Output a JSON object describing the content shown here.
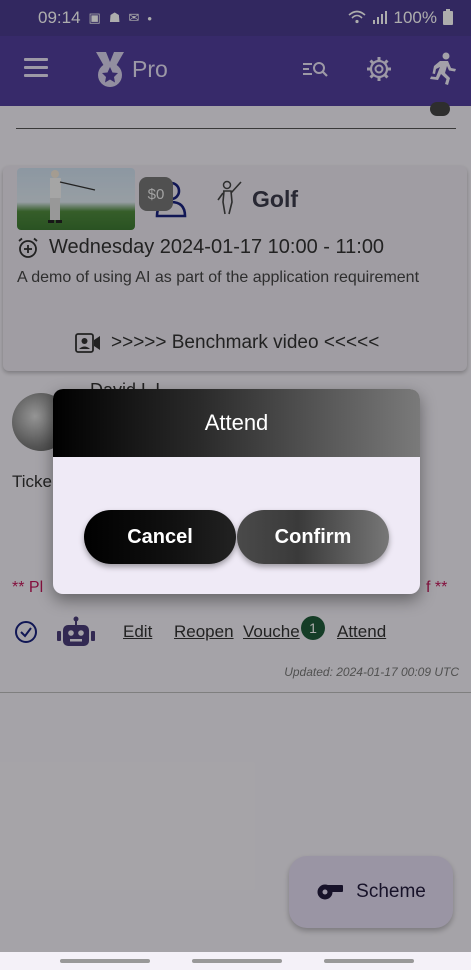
{
  "statusbar": {
    "time": "09:14",
    "battery": "100%"
  },
  "appbar": {
    "brand": "Pro"
  },
  "event": {
    "price": "$0",
    "sport": "Golf",
    "datetime": "Wednesday 2024-01-17 10:00 - 11:00",
    "description": "A demo of using AI as part of the application requirement",
    "video_label": ">>>>> Benchmark video <<<<<"
  },
  "host": {
    "name": "David L L"
  },
  "tickets_label": "Ticke",
  "notice_left": "** Pl",
  "notice_right": "f **",
  "actions": {
    "edit": "Edit",
    "reopen": "Reopen",
    "voucher": "Vouche",
    "voucher_badge": "1",
    "attend": "Attend"
  },
  "updated": "Updated: 2024-01-17 00:09 UTC",
  "fab": {
    "label": "Scheme"
  },
  "dialog": {
    "title": "Attend",
    "cancel_label": "Cancel",
    "confirm_label": "Confirm"
  },
  "colors": {
    "appbar": "#513f9c",
    "badge": "#1f5b3a",
    "notice": "#c2185b"
  }
}
